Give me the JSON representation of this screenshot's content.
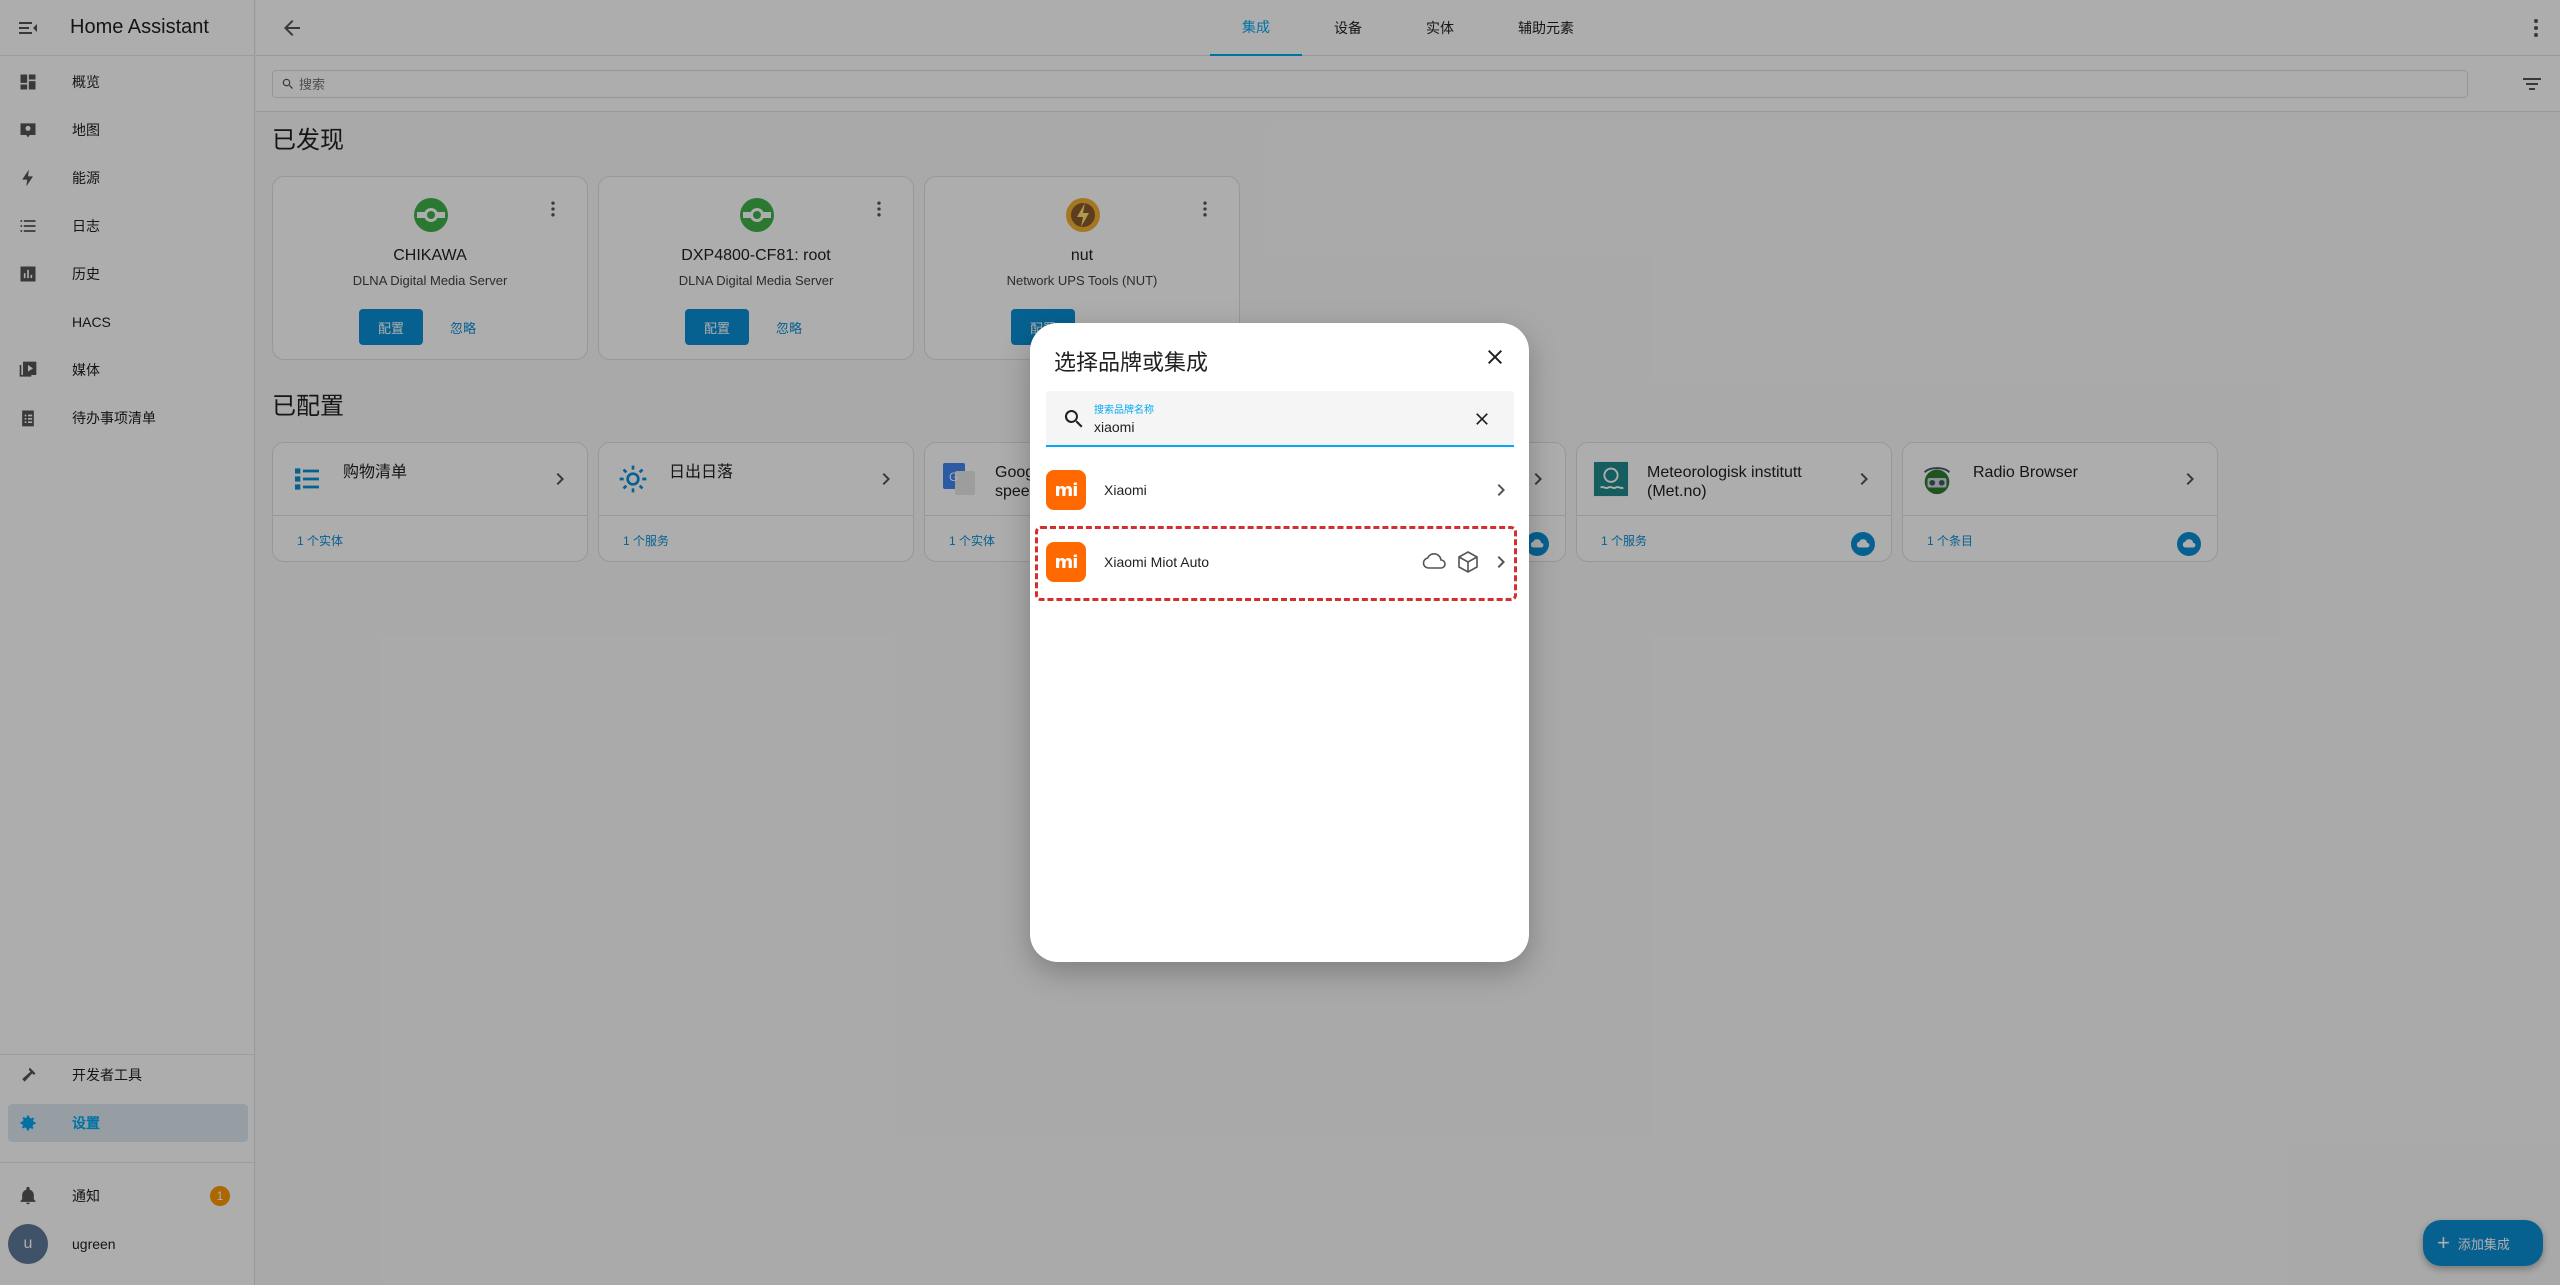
{
  "app": {
    "title": "Home Assistant"
  },
  "sidebar": {
    "items": [
      {
        "label": "概览",
        "icon": "dashboard-icon"
      },
      {
        "label": "地图",
        "icon": "map-icon"
      },
      {
        "label": "能源",
        "icon": "lightning-icon"
      },
      {
        "label": "日志",
        "icon": "list-icon"
      },
      {
        "label": "历史",
        "icon": "chart-icon"
      },
      {
        "label": "HACS",
        "icon": "hacs-icon"
      },
      {
        "label": "媒体",
        "icon": "media-icon"
      },
      {
        "label": "待办事项清单",
        "icon": "clipboard-list-icon"
      }
    ],
    "dev_tools": "开发者工具",
    "settings": "设置",
    "notifications": "通知",
    "notification_count": "1",
    "user": "ugreen",
    "avatar_letter": "u"
  },
  "tabs": [
    {
      "label": "集成",
      "active": true
    },
    {
      "label": "设备"
    },
    {
      "label": "实体"
    },
    {
      "label": "辅助元素"
    }
  ],
  "search": {
    "placeholder": "搜索"
  },
  "discovered": {
    "title": "已发现",
    "cards": [
      {
        "name": "CHIKAWA",
        "desc": "DLNA Digital Media Server",
        "configure": "配置",
        "ignore": "忽略",
        "icon": "dlna-icon"
      },
      {
        "name": "DXP4800-CF81: root",
        "desc": "DLNA Digital Media Server",
        "configure": "配置",
        "ignore": "忽略",
        "icon": "dlna-icon"
      },
      {
        "name": "nut",
        "desc": "Network UPS Tools (NUT)",
        "configure": "配置",
        "icon": "nut-icon"
      }
    ]
  },
  "configured": {
    "title": "已配置",
    "cards": [
      {
        "name": "购物清单",
        "foot": "1 个实体",
        "icon": "shopping-list-icon"
      },
      {
        "name": "日出日落",
        "foot": "1 个服务",
        "icon": "sun-icon"
      },
      {
        "name": "Goog\nspee",
        "foot": "1 个实体",
        "icon": "google-translate-icon"
      },
      {
        "name": "",
        "foot": "",
        "icon": "cloud-icon"
      },
      {
        "name": "Meteorologisk institutt (Met.no)",
        "foot": "1 个服务",
        "icon": "met-icon"
      },
      {
        "name": "Radio Browser",
        "foot": "1 个条目",
        "icon": "radio-icon"
      }
    ]
  },
  "fab": {
    "label": "添加集成"
  },
  "dialog": {
    "title": "选择品牌或集成",
    "field_label": "搜索品牌名称",
    "field_value": "xiaomi",
    "results": [
      {
        "name": "Xiaomi",
        "logo_text": "mi"
      },
      {
        "name": "Xiaomi Miot Auto",
        "logo_text": "mi"
      }
    ]
  },
  "colors": {
    "accent": "#03a9f4",
    "primary": "#0a8fd6",
    "xiaomi": "#ff6900",
    "highlight": "#d32f2f"
  }
}
